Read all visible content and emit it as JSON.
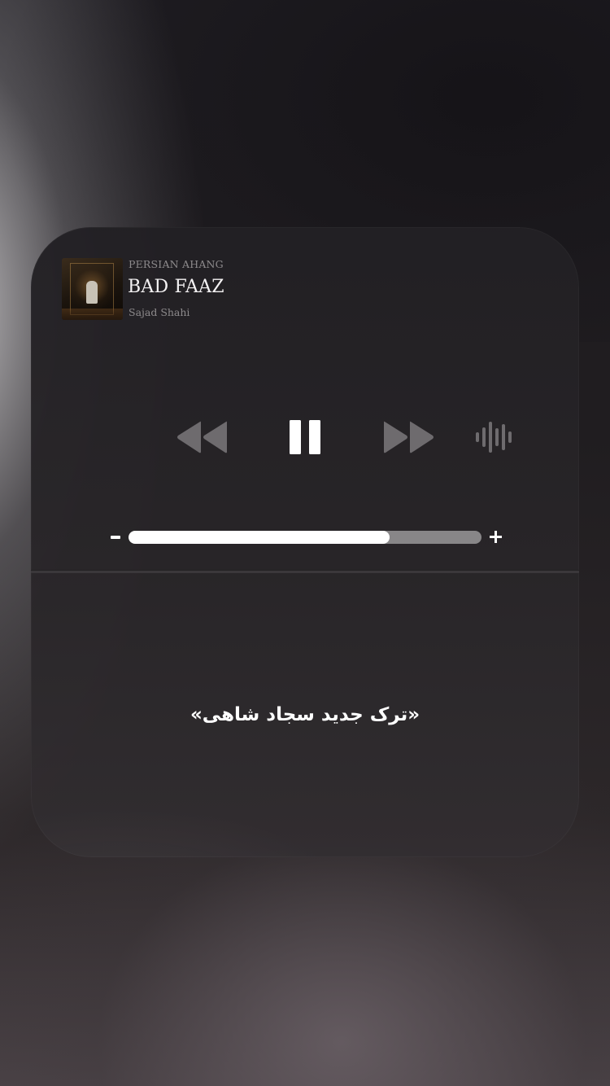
{
  "now_playing": {
    "source_label": "PERSIAN AHANG",
    "track_title": "BAD FAAZ",
    "artist": "Sajad Shahi",
    "album_art": "album-cover-image"
  },
  "controls": {
    "rewind_icon": "rewind-icon",
    "pause_icon": "pause-icon",
    "forward_icon": "fast-forward-icon",
    "waveform_icon": "waveform-icon"
  },
  "volume": {
    "minus_icon": "minus-icon",
    "plus_icon": "plus-icon",
    "level_percent": 74
  },
  "caption": "«ترک جدید سجاد شاهی»",
  "colors": {
    "primary_text": "#f4f2f3",
    "secondary_text": "#8d8a8c",
    "icon_gray": "#6e6b6e",
    "icon_white": "#ffffff"
  }
}
